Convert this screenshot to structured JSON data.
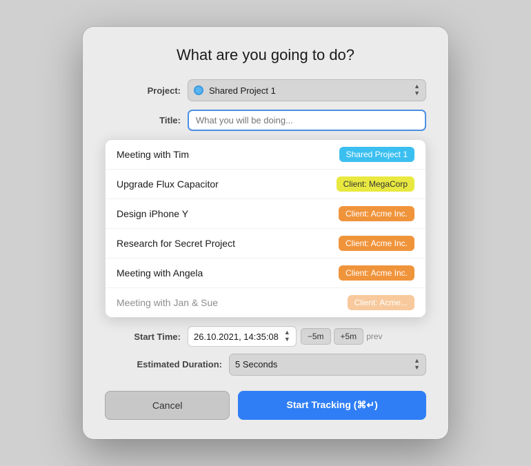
{
  "dialog": {
    "title": "What are you going to do?",
    "project_label": "Project:",
    "title_label": "Title:",
    "start_time_label": "Start Time:",
    "estimated_label": "Estimated Duration:",
    "project_value": "Shared Project 1",
    "title_placeholder": "What you will be doing...",
    "start_time_value": "26.10.2021, 14:35:08",
    "minus5_label": "−5m",
    "plus5_label": "+5m",
    "prev_label": "prev",
    "estimated_value": "5 Seconds",
    "cancel_label": "Cancel",
    "start_label": "Start Tracking (⌘↵)"
  },
  "dropdown_items": [
    {
      "name": "Meeting with Tim",
      "badge": "Shared Project 1",
      "badge_class": "badge-shared"
    },
    {
      "name": "Upgrade Flux Capacitor",
      "badge": "Client: MegaCorp",
      "badge_class": "badge-megacorp"
    },
    {
      "name": "Design iPhone Y",
      "badge": "Client: Acme Inc.",
      "badge_class": "badge-acme"
    },
    {
      "name": "Research for Secret Project",
      "badge": "Client: Acme Inc.",
      "badge_class": "badge-acme"
    },
    {
      "name": "Meeting with Angela",
      "badge": "Client: Acme Inc.",
      "badge_class": "badge-acme"
    },
    {
      "name": "Meeting with Jan & Sue",
      "badge": "Client: Acme...",
      "badge_class": "badge-acme"
    }
  ]
}
